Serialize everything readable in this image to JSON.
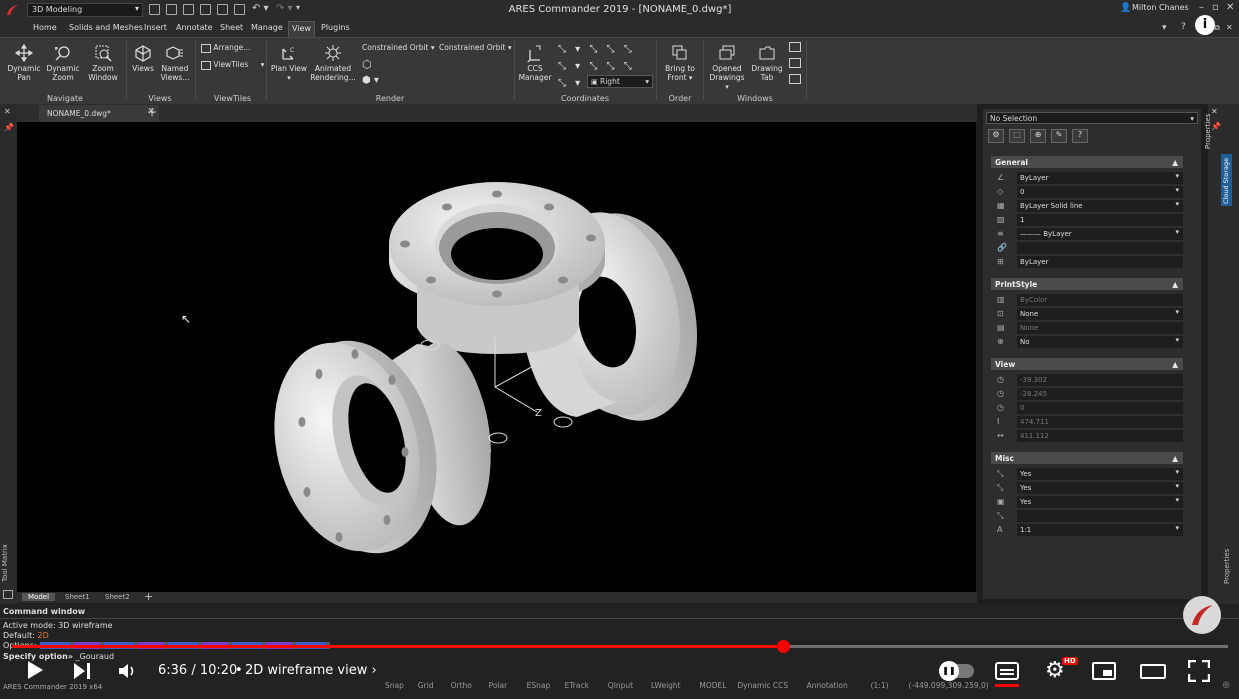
{
  "titlebar": {
    "workspace": "3D Modeling",
    "app_title": "ARES Commander 2019 - [NONAME_0.dwg*]",
    "user": "Milton Chanes"
  },
  "menu_tabs": [
    "Home",
    "Solids and Meshes",
    "Insert",
    "Annotate",
    "Sheet",
    "Manage",
    "View",
    "Plugins"
  ],
  "ribbon": {
    "navigate": {
      "dynamic_pan": "Dynamic Pan",
      "dynamic_zoom": "Dynamic Zoom",
      "zoom_window": "Zoom Window",
      "group": "Navigate"
    },
    "views": {
      "views": "Views",
      "named_views": "Named Views...",
      "group": "Views"
    },
    "viewtiles": {
      "arrange": "Arrange...",
      "viewtiles": "ViewTiles",
      "group": "ViewTiles"
    },
    "render": {
      "plan_view": "Plan View",
      "animated_rendering": "Animated Rendering...",
      "constrained_orbit_1": "Constrained Orbit",
      "constrained_orbit_2": "Constrained Orbit",
      "group": "Render"
    },
    "coordinates": {
      "ccs_manager": "CCS Manager",
      "view_select": "Right",
      "group": "Coordinates"
    },
    "order": {
      "bring_to_front": "Bring to Front",
      "group": "Order"
    },
    "windows": {
      "opened_drawings": "Opened Drawings",
      "drawing_tab": "Drawing Tab",
      "group": "Windows"
    }
  },
  "document_tab": "NONAME_0.dwg*",
  "sheet_tabs": [
    "Model",
    "Sheet1",
    "Sheet2"
  ],
  "properties": {
    "selection": "No Selection",
    "general_title": "General",
    "general_rows": [
      "ByLayer",
      "0",
      "ByLayer    Solid line",
      "1",
      "——— ByLayer",
      "",
      "ByLayer"
    ],
    "printstyle_title": "PrintStyle",
    "printstyle_rows": [
      "ByColor",
      "None",
      "None",
      "No"
    ],
    "view_title": "View",
    "view_rows": [
      "-39.302",
      "-28.245",
      "0",
      "474.711",
      "411.112"
    ],
    "misc_title": "Misc",
    "misc_rows": [
      "Yes",
      "Yes",
      "Yes",
      "",
      "1:1"
    ]
  },
  "side_labels": {
    "properties": "Properties",
    "cloud_storage": "Cloud Storage",
    "tool_matrix": "Tool Matrix",
    "properties_bottom": "Properties"
  },
  "command": {
    "title": "Command window",
    "line1": "Active mode: 3D wireframe",
    "line2_label": "Default:",
    "line2_value": "2D",
    "line3": "Options:",
    "line4_label": "Specify option»",
    "line4_value": "_Gouraud"
  },
  "video": {
    "time": "6:36 / 10:20",
    "chapter": "2D wireframe view",
    "progress": 0.634,
    "accent": "#ff0000"
  },
  "statusbar": {
    "app": "ARES Commander 2019 x64",
    "items": [
      "Snap",
      "Grid",
      "Ortho",
      "Polar",
      "ESnap",
      "ETrack",
      "QInput",
      "LWeight",
      "MODEL",
      "Dynamic CCS",
      "Annotation",
      "(1:1)",
      "(-449.099,309.259,0)"
    ]
  }
}
